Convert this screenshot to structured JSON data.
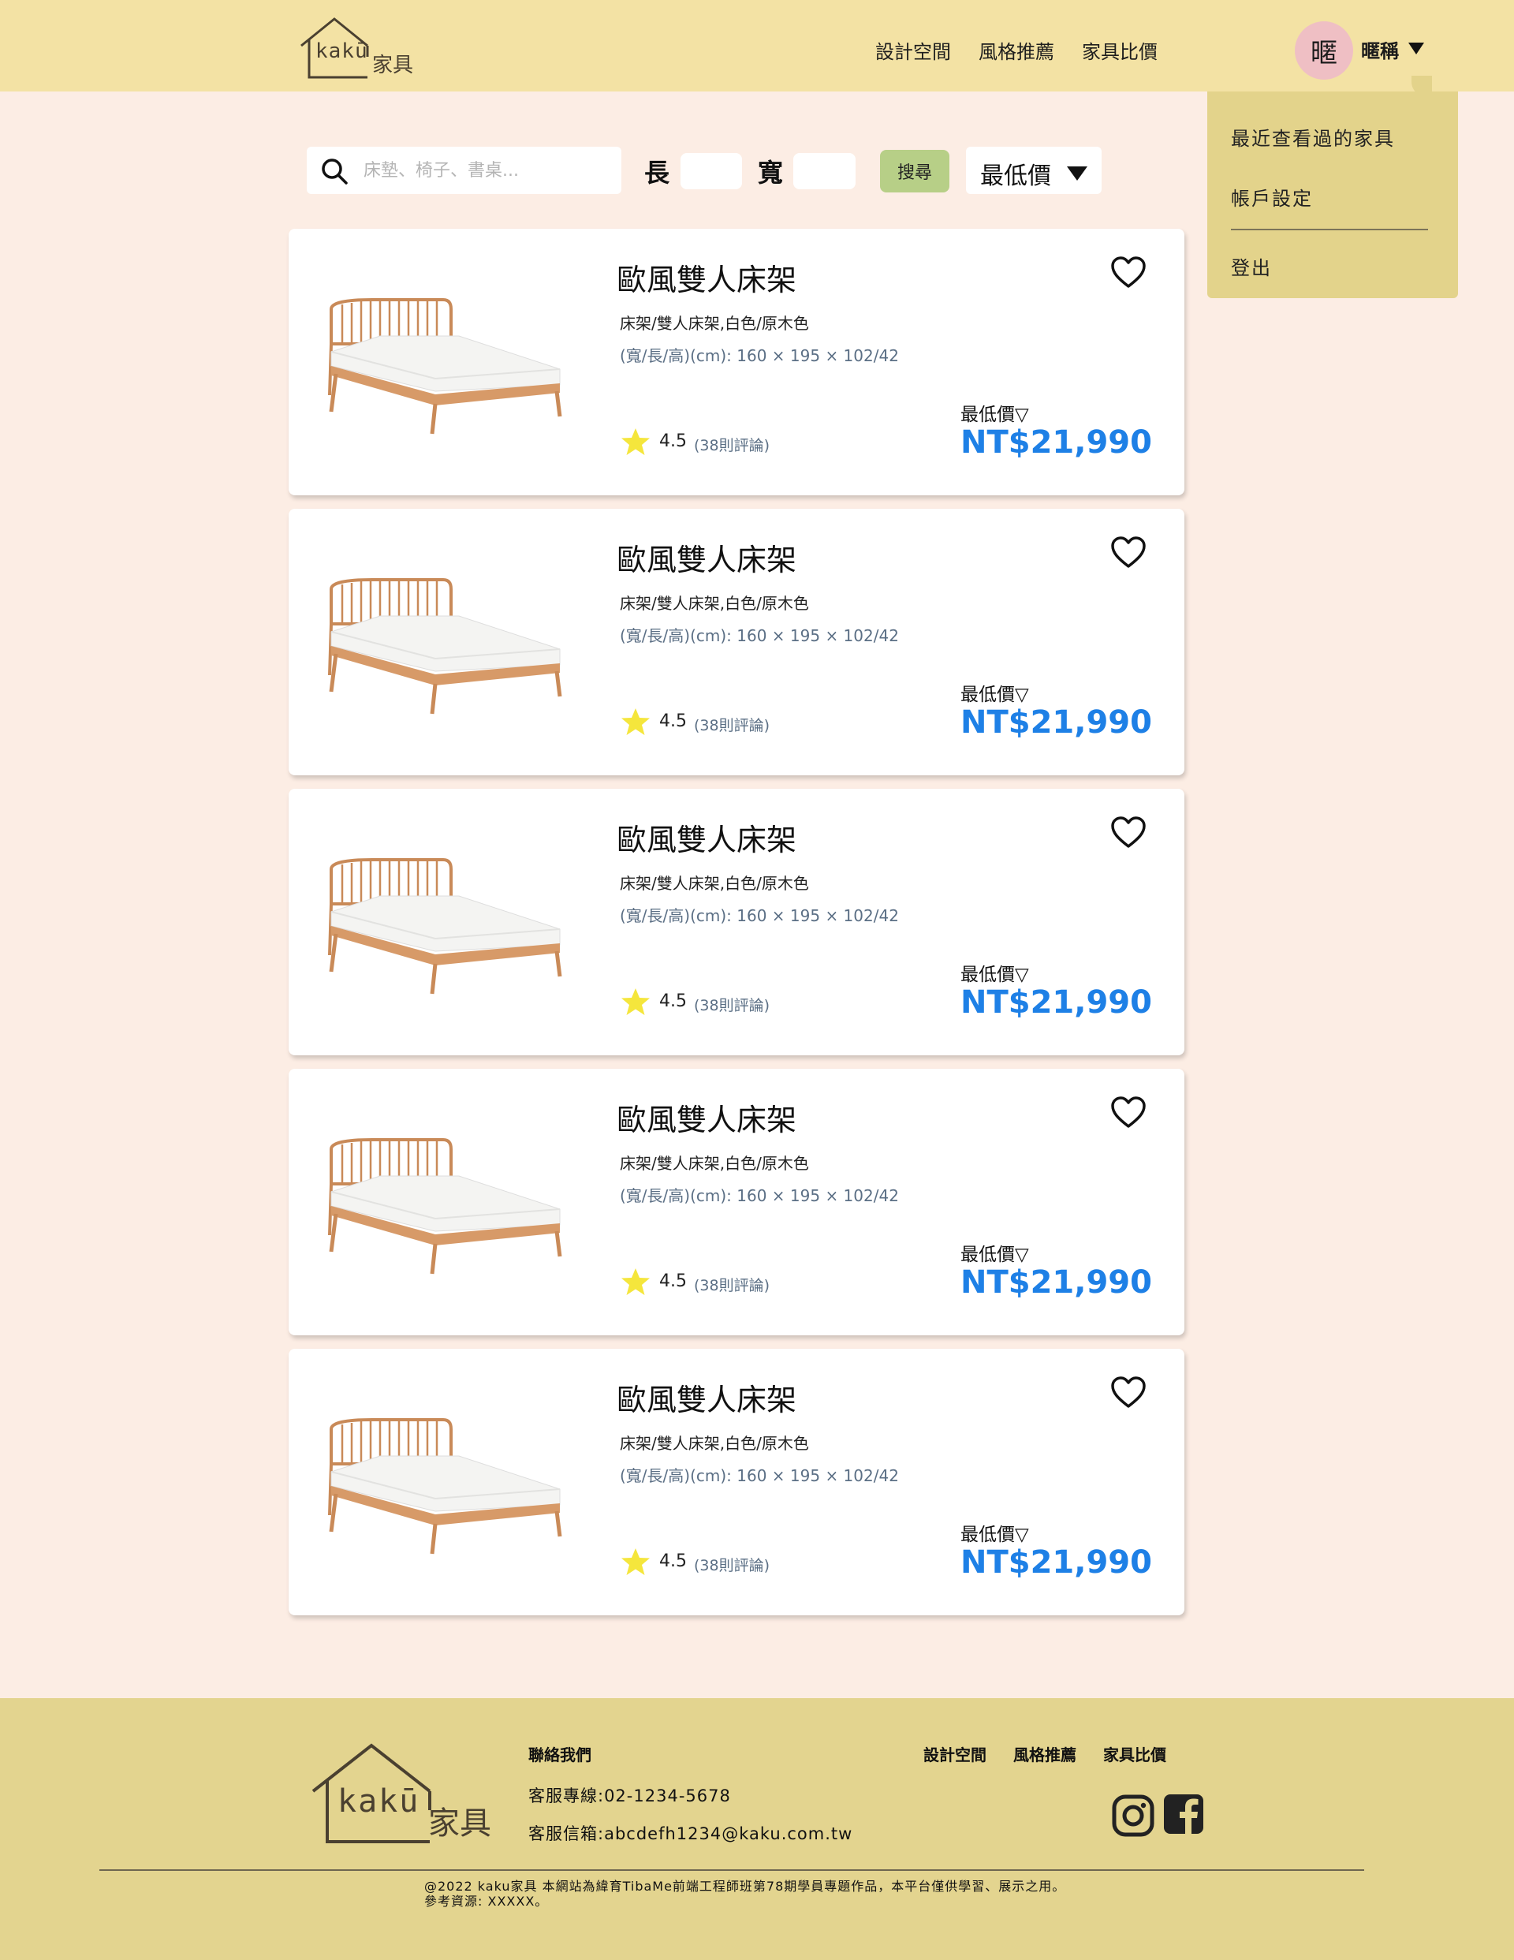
{
  "header": {
    "logo_text": "kakū",
    "logo_cn": "家具",
    "nav": [
      "設計空間",
      "風格推薦",
      "家具比價"
    ],
    "avatar_char": "暱",
    "nickname": "暱稱"
  },
  "dropdown": {
    "items": [
      "最近查看過的家具",
      "帳戶設定",
      "登出"
    ]
  },
  "search": {
    "placeholder": "床墊、椅子、書桌...",
    "length_label": "長",
    "width_label": "寬",
    "button": "搜尋",
    "sort_value": "最低價"
  },
  "products": [
    {
      "name": "歐風雙人床架",
      "category": "床架/雙人床架,白色/原木色",
      "dimensions": "(寬/長/高)(cm): 160 × 195 × 102/42",
      "rating": "4.5",
      "reviews": "(38則評論)",
      "price_label": "最低價▽",
      "price": "NT$21,990"
    },
    {
      "name": "歐風雙人床架",
      "category": "床架/雙人床架,白色/原木色",
      "dimensions": "(寬/長/高)(cm): 160 × 195 × 102/42",
      "rating": "4.5",
      "reviews": "(38則評論)",
      "price_label": "最低價▽",
      "price": "NT$21,990"
    },
    {
      "name": "歐風雙人床架",
      "category": "床架/雙人床架,白色/原木色",
      "dimensions": "(寬/長/高)(cm): 160 × 195 × 102/42",
      "rating": "4.5",
      "reviews": "(38則評論)",
      "price_label": "最低價▽",
      "price": "NT$21,990"
    },
    {
      "name": "歐風雙人床架",
      "category": "床架/雙人床架,白色/原木色",
      "dimensions": "(寬/長/高)(cm): 160 × 195 × 102/42",
      "rating": "4.5",
      "reviews": "(38則評論)",
      "price_label": "最低價▽",
      "price": "NT$21,990"
    },
    {
      "name": "歐風雙人床架",
      "category": "床架/雙人床架,白色/原木色",
      "dimensions": "(寬/長/高)(cm): 160 × 195 × 102/42",
      "rating": "4.5",
      "reviews": "(38則評論)",
      "price_label": "最低價▽",
      "price": "NT$21,990"
    }
  ],
  "footer": {
    "logo_text": "kakū",
    "logo_cn": "家具",
    "contact_title": "聯絡我們",
    "phone": "客服專線:02-1234-5678",
    "email": "客服信箱:abcdefh1234@kaku.com.tw",
    "nav": [
      "設計空間",
      "風格推薦",
      "家具比價"
    ],
    "social": [
      "instagram-icon",
      "facebook-icon"
    ],
    "copyright_line1": "@2022 kaku家具 本網站為緯育TibaMe前端工程師班第78期學員專題作品，本平台僅供學習、展示之用。",
    "copyright_line2": "參考資源: XXXXX。"
  },
  "colors": {
    "header_bg": "#f3e2a4",
    "page_bg": "#fcede4",
    "dropdown_bg": "#e3d38b",
    "search_button": "#b7cf87",
    "price": "#1e80e6",
    "avatar_bg": "#efbfc4",
    "footer_bg": "#e3d48f"
  }
}
